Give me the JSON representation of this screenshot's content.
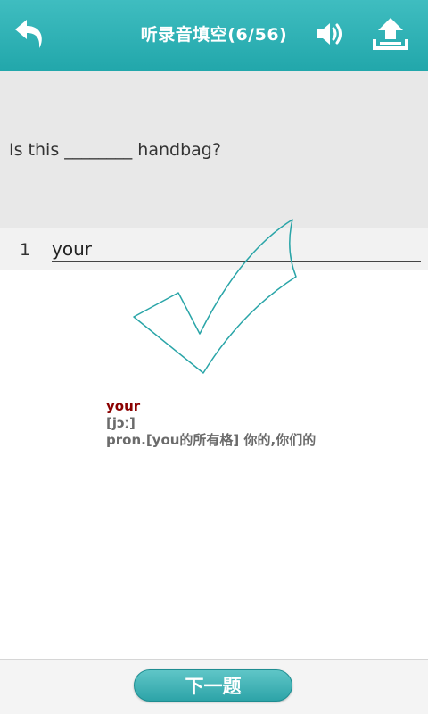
{
  "header": {
    "title": "听录音填空(6/56)",
    "icons": {
      "back": "back-arrow-icon",
      "sound": "speaker-icon",
      "upload": "upload-icon"
    }
  },
  "question": {
    "text": "Is this ________ handbag?"
  },
  "answer": {
    "index": "1",
    "value": "your"
  },
  "dictionary": {
    "word": "your",
    "phonetic": "[jɔː]",
    "definition": "pron.[you的所有格] 你的,你们的"
  },
  "footer": {
    "next_label": "下一题"
  },
  "colors": {
    "accent": "#2aaeb1",
    "word": "#8b0000",
    "definition": "#6b6b6b"
  }
}
